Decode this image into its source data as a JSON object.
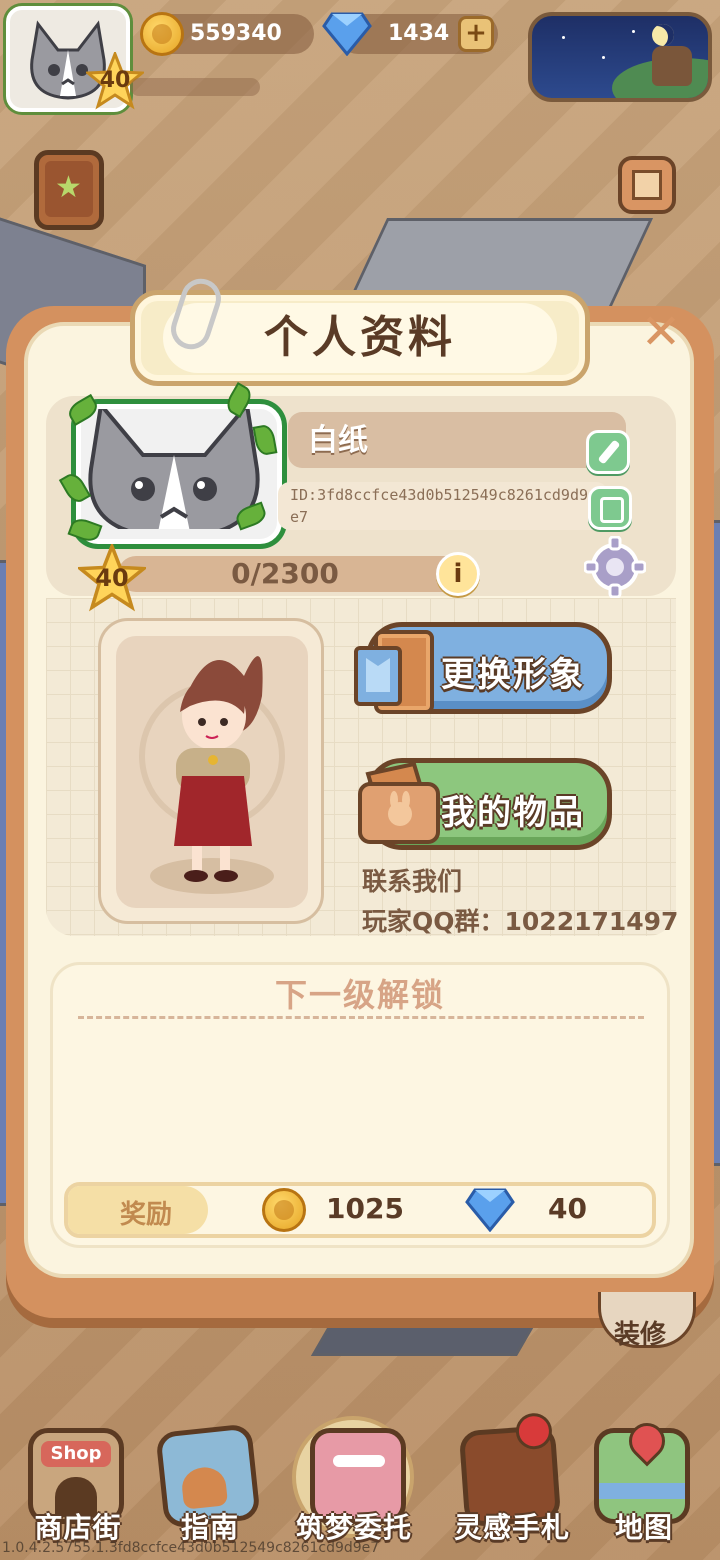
{
  "hud": {
    "level": "40",
    "coins": "559340",
    "gems": "1434",
    "add_label": "+"
  },
  "panel": {
    "title": "个人资料",
    "close_label": "✕",
    "nickname": "白纸",
    "player_id": "ID:3fd8ccfce43d0b512549c8261cd9d9e7",
    "level": "40",
    "xp_text": "0/2300",
    "xp_current": 0,
    "xp_total": 2300,
    "info_label": "i",
    "change_look_label": "更换形象",
    "my_items_label": "我的物品",
    "contact_title": "联系我们",
    "qq_group": "玩家QQ群：1022171497",
    "unlock_title": "下一级解锁",
    "reward_label": "奖励",
    "reward_coins": "1025",
    "reward_gems": "40"
  },
  "decor_label": "装修",
  "nav": {
    "items": [
      {
        "label": "商店街",
        "icon": "shop-icon"
      },
      {
        "label": "指南",
        "icon": "guide-book-icon"
      },
      {
        "label": "筑梦委托",
        "icon": "notebook-icon"
      },
      {
        "label": "灵感手札",
        "icon": "journal-icon"
      },
      {
        "label": "地图",
        "icon": "map-icon"
      }
    ],
    "shop_sign": "Shop"
  },
  "footer": "1.0.4.2.5755.1.3fd8ccfce43d0b512549c8261cd9d9e7",
  "colors": {
    "panel_border": "#d4915f",
    "panel_bg": "#fbf4df",
    "change_btn": "#7fb0e0",
    "items_btn": "#8dc77e",
    "title_text": "#5a3b26"
  }
}
